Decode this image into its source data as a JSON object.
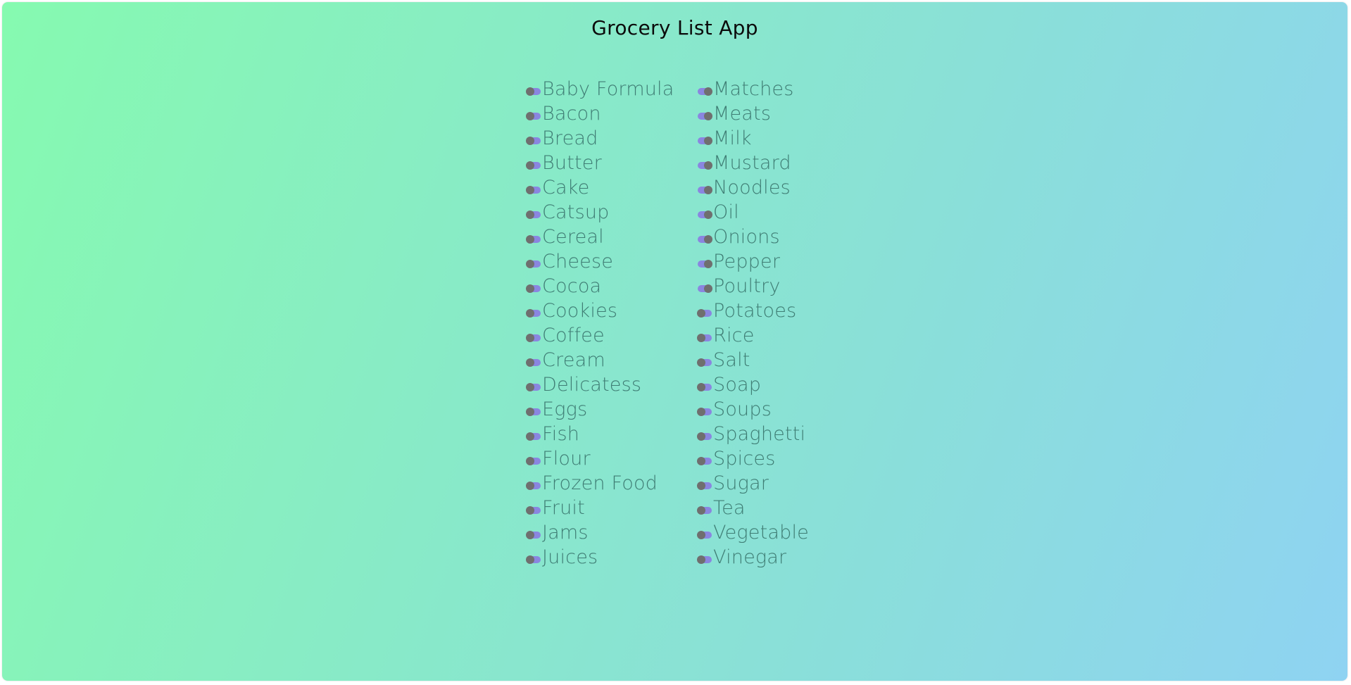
{
  "app": {
    "title": "Grocery List App"
  },
  "colors": {
    "toggle_track": "#8a86e0",
    "toggle_knob": "#6f6f6f",
    "label": "#3f7d74"
  },
  "columns": [
    {
      "items": [
        {
          "label": "Baby Formula",
          "checked": false
        },
        {
          "label": "Bacon",
          "checked": false
        },
        {
          "label": "Bread",
          "checked": false
        },
        {
          "label": "Butter",
          "checked": false
        },
        {
          "label": "Cake",
          "checked": false
        },
        {
          "label": "Catsup",
          "checked": false
        },
        {
          "label": "Cereal",
          "checked": false
        },
        {
          "label": "Cheese",
          "checked": false
        },
        {
          "label": "Cocoa",
          "checked": false
        },
        {
          "label": "Cookies",
          "checked": false
        },
        {
          "label": "Coffee",
          "checked": false
        },
        {
          "label": "Cream",
          "checked": false
        },
        {
          "label": "Delicatess",
          "checked": false
        },
        {
          "label": "Eggs",
          "checked": false
        },
        {
          "label": "Fish",
          "checked": false
        },
        {
          "label": "Flour",
          "checked": false
        },
        {
          "label": "Frozen Food",
          "checked": false
        },
        {
          "label": "Fruit",
          "checked": false
        },
        {
          "label": "Jams",
          "checked": false
        },
        {
          "label": "Juices",
          "checked": false
        }
      ]
    },
    {
      "items": [
        {
          "label": "Matches",
          "checked": true
        },
        {
          "label": "Meats",
          "checked": true
        },
        {
          "label": "Milk",
          "checked": true
        },
        {
          "label": "Mustard",
          "checked": true
        },
        {
          "label": "Noodles",
          "checked": true
        },
        {
          "label": "Oil",
          "checked": true
        },
        {
          "label": "Onions",
          "checked": true
        },
        {
          "label": "Pepper",
          "checked": true
        },
        {
          "label": "Poultry",
          "checked": true
        },
        {
          "label": "Potatoes",
          "checked": false
        },
        {
          "label": "Rice",
          "checked": false
        },
        {
          "label": "Salt",
          "checked": false
        },
        {
          "label": "Soap",
          "checked": false
        },
        {
          "label": "Soups",
          "checked": false
        },
        {
          "label": "Spaghetti",
          "checked": false
        },
        {
          "label": "Spices",
          "checked": false
        },
        {
          "label": "Sugar",
          "checked": false
        },
        {
          "label": "Tea",
          "checked": false
        },
        {
          "label": "Vegetable",
          "checked": false
        },
        {
          "label": "Vinegar",
          "checked": false
        }
      ]
    }
  ]
}
